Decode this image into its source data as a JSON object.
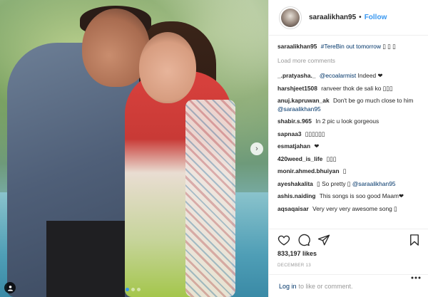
{
  "post": {
    "username": "saraalikhan95",
    "separator": "•",
    "follow_label": "Follow",
    "caption_user": "saraalikhan95",
    "caption_text": "#TereBin out tomorrow",
    "caption_emoji": "▯ ▯ ▯",
    "load_more_label": "Load more comments",
    "likes": "833,197 likes",
    "date": "DECEMBER 13",
    "login_link": "Log in",
    "login_text": "to like or comment.",
    "carousel_count": 3,
    "carousel_active": 0
  },
  "comments": [
    {
      "user": "_.pratyasha._",
      "mention": "@ecoalarmist",
      "text": "Indeed ❤"
    },
    {
      "user": "harshjeet1508",
      "mention": "",
      "text": "ranveer thok de sali ko ▯▯▯"
    },
    {
      "user": "anuj.kapruwan_ak",
      "mention": "",
      "text": "Don't be go much close to him",
      "mention_after": "@saraalikhan95"
    },
    {
      "user": "shabir.s.965",
      "mention": "",
      "text": "In 2 pic u look gorgeous"
    },
    {
      "user": "sapnaa3",
      "mention": "",
      "text": "▯▯▯▯▯▯"
    },
    {
      "user": "esmatjahan",
      "mention": "",
      "text": "❤"
    },
    {
      "user": "420weed_is_life",
      "mention": "",
      "text": "▯▯▯"
    },
    {
      "user": "monir.ahmed.bhuiyan",
      "mention": "",
      "text": "▯"
    },
    {
      "user": "ayeshakalita",
      "mention": "",
      "text": "▯ So pretty ▯",
      "mention_after": "@saraalikhan95"
    },
    {
      "user": "ashis.naiding",
      "mention": "",
      "text": "This songs is soo good Maam❤"
    },
    {
      "user": "aqsaqaisar",
      "mention": "",
      "text": "Very very very awesome song ▯"
    }
  ],
  "icons": {
    "heart": "heart-icon",
    "comment": "comment-icon",
    "share": "share-icon",
    "save": "bookmark-icon",
    "next": "chevron-right-icon",
    "tag": "user-tag-icon",
    "more": "more-icon"
  },
  "colors": {
    "link": "#3897f0",
    "mention": "#003569",
    "muted": "#999999",
    "border": "#efefef"
  }
}
